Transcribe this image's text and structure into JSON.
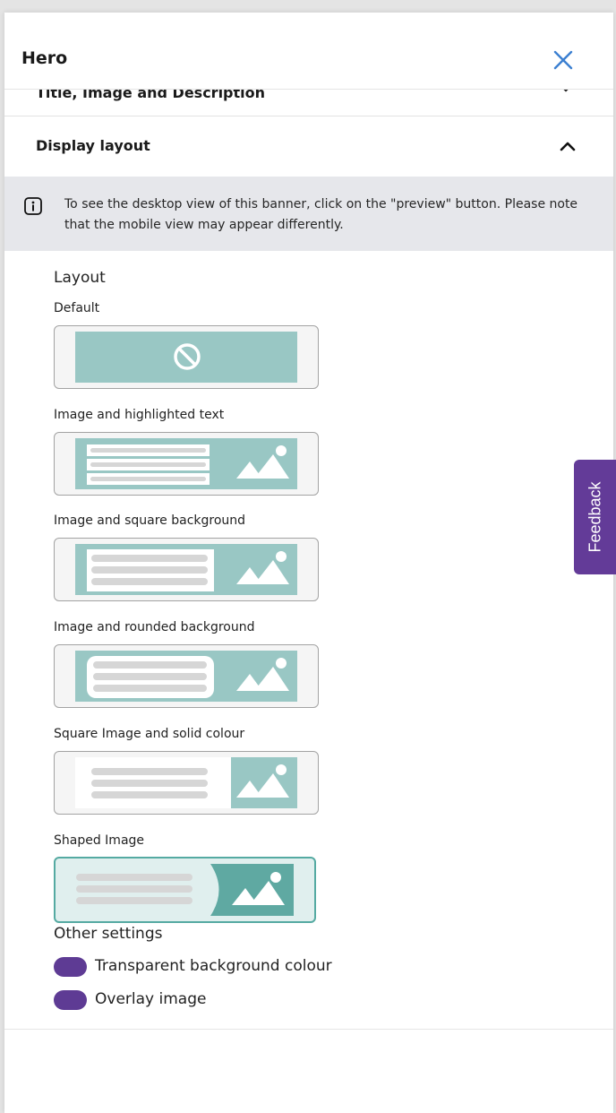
{
  "panel": {
    "title": "Hero",
    "close_icon": "close-icon"
  },
  "previous_section": {
    "label": "Title, Image and Description",
    "icon": "chevron-down-icon"
  },
  "section": {
    "title": "Display layout",
    "expanded": true,
    "icon": "chevron-up-icon"
  },
  "info": {
    "icon": "info-icon",
    "text": "To see the desktop view of this banner, click on the \"preview\" button. Please note that the mobile view may appear differently."
  },
  "layout": {
    "heading": "Layout",
    "options": [
      {
        "label": "Default",
        "icon": "no-image-icon",
        "selected": false
      },
      {
        "label": "Image and highlighted text",
        "icon": "image-icon",
        "selected": false
      },
      {
        "label": "Image and square background",
        "icon": "image-icon",
        "selected": false
      },
      {
        "label": "Image and rounded background",
        "icon": "image-icon",
        "selected": false
      },
      {
        "label": "Square Image and solid colour",
        "icon": "image-icon",
        "selected": false
      },
      {
        "label": "Shaped Image",
        "icon": "image-icon",
        "selected": true
      }
    ]
  },
  "other_settings": {
    "heading": "Other settings",
    "toggles": [
      {
        "label": "Transparent background colour",
        "enabled": true
      },
      {
        "label": "Overlay image",
        "enabled": true
      }
    ]
  },
  "feedback": {
    "label": "Feedback"
  },
  "colors": {
    "teal": "#99c7c4",
    "teal_dark": "#5fa9a2",
    "placeholder_line": "#d6d6d6",
    "toggle_purple": "#5e3b94",
    "feedback_purple": "#633b98",
    "info_background": "#e6e7eb",
    "close_blue": "#3b7fd1"
  }
}
